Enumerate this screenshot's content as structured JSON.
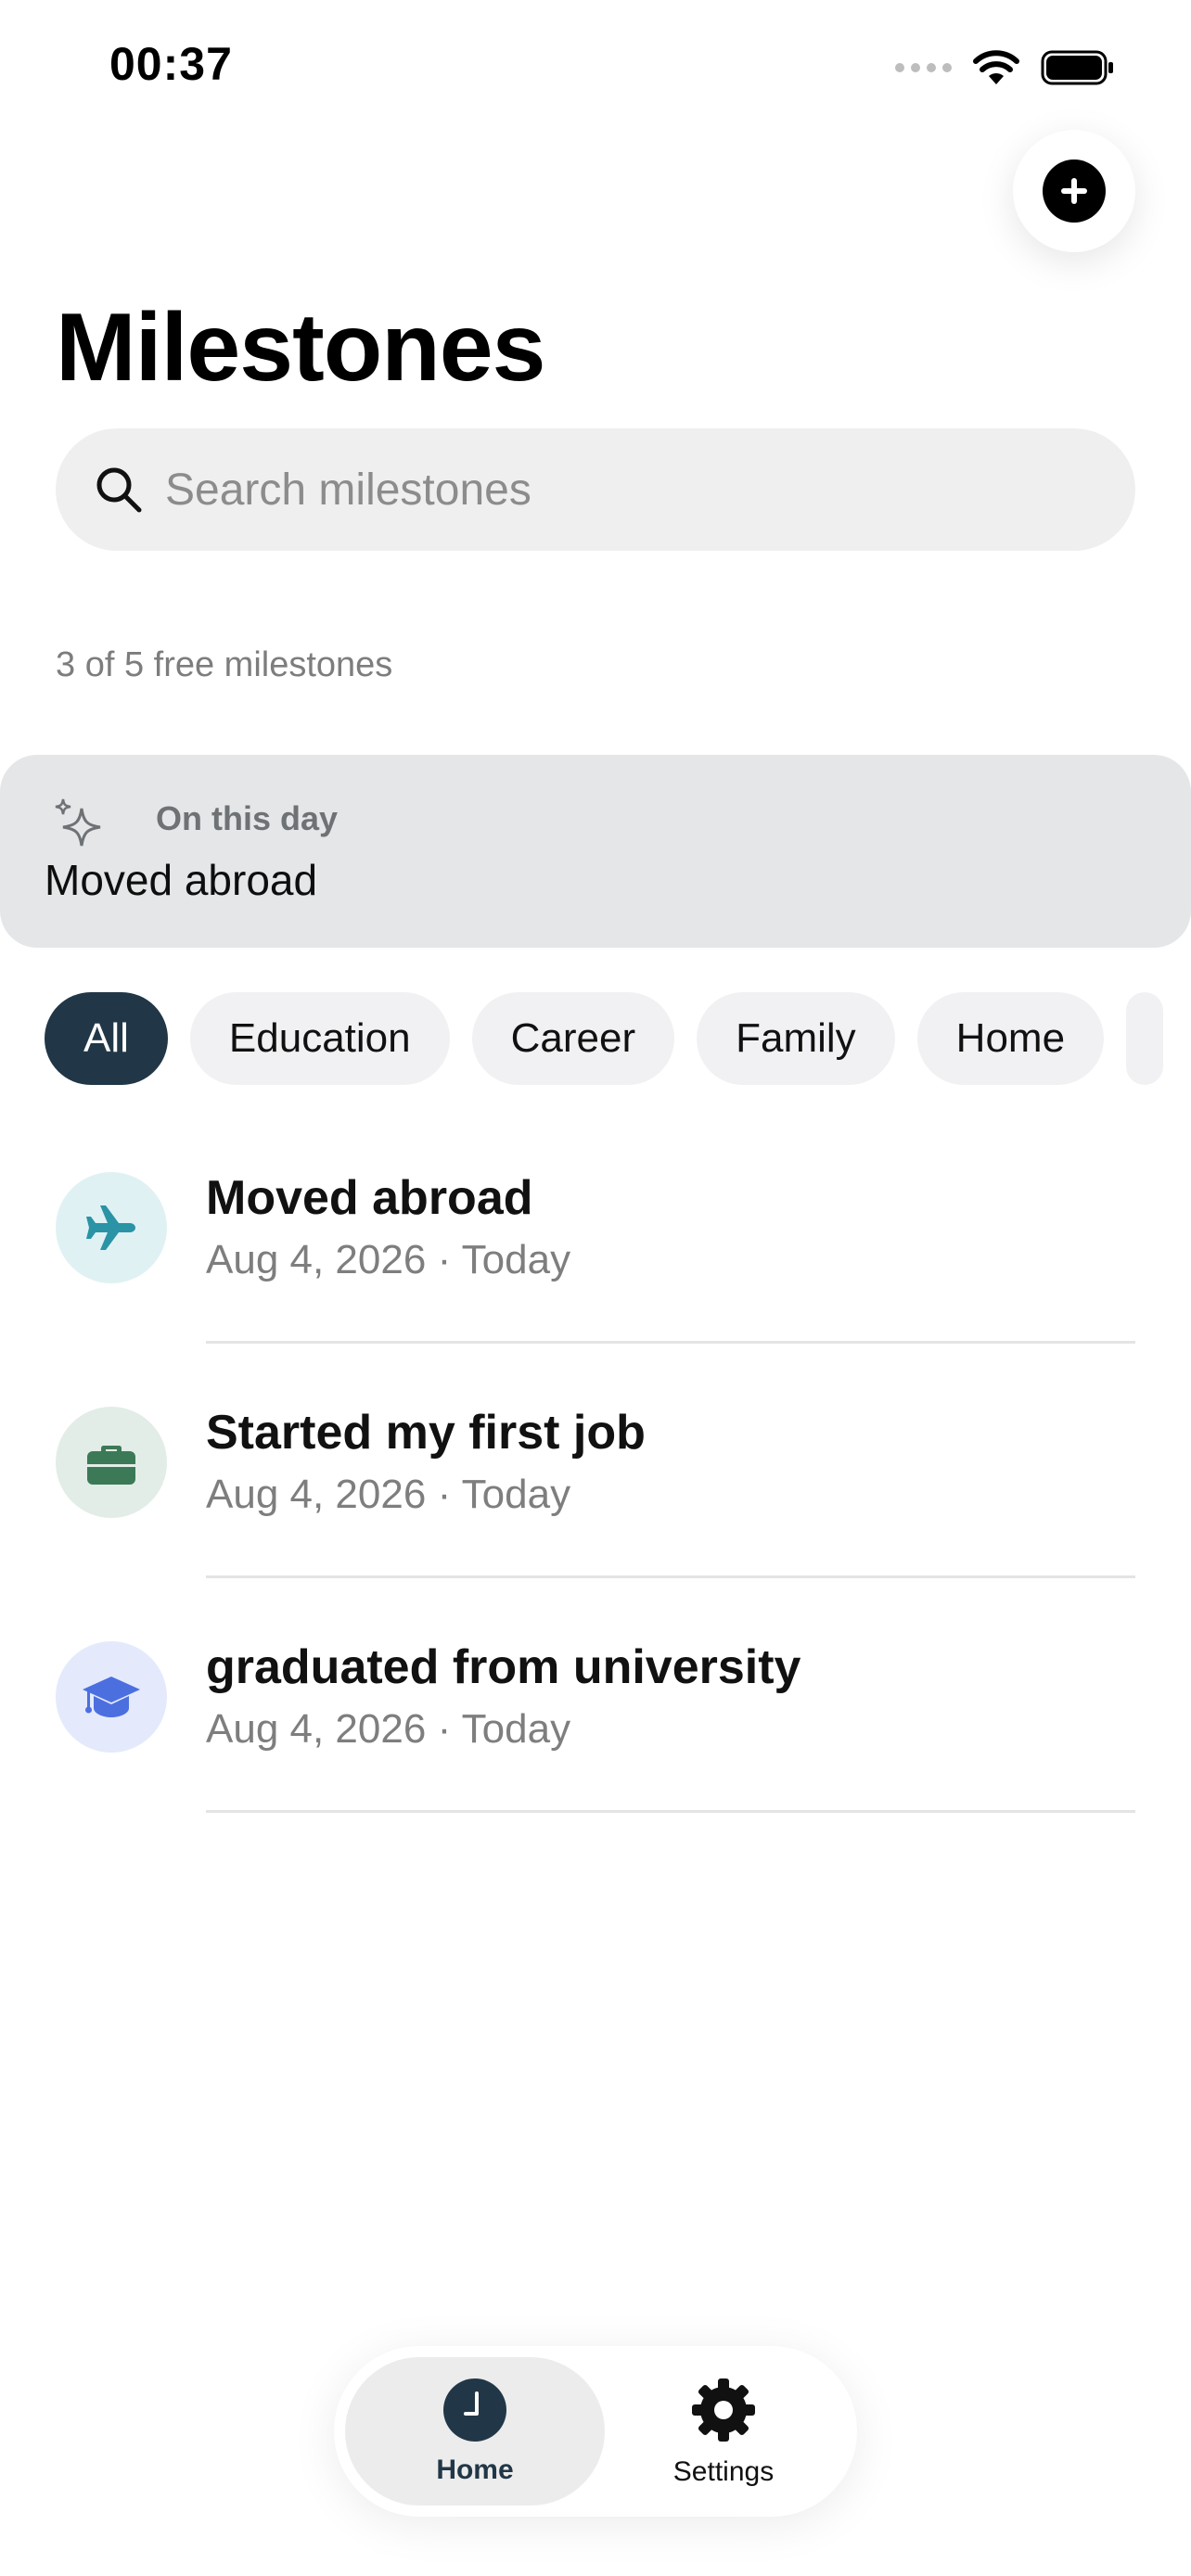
{
  "status_bar": {
    "time": "00:37"
  },
  "header": {
    "title": "Milestones",
    "add_icon": "plus-circle-icon"
  },
  "search": {
    "placeholder": "Search milestones"
  },
  "quota": {
    "text": "3 of 5 free milestones"
  },
  "on_this_day": {
    "label": "On this day",
    "title": "Moved abroad",
    "icon": "sparkle-icon"
  },
  "filters": [
    {
      "label": "All",
      "active": true
    },
    {
      "label": "Education",
      "active": false
    },
    {
      "label": "Career",
      "active": false
    },
    {
      "label": "Family",
      "active": false
    },
    {
      "label": "Home",
      "active": false
    }
  ],
  "milestones": [
    {
      "title": "Moved abroad",
      "date": "Aug 4, 2026",
      "relative": "Today",
      "icon": "airplane-icon",
      "icon_color": "#2a93a6",
      "bg_color": "#e0f1f4"
    },
    {
      "title": "Started my first job",
      "date": "Aug 4, 2026",
      "relative": "Today",
      "icon": "briefcase-icon",
      "icon_color": "#3c7a57",
      "bg_color": "#e3ede7"
    },
    {
      "title": "graduated from university",
      "date": "Aug 4, 2026",
      "relative": "Today",
      "icon": "graduation-cap-icon",
      "icon_color": "#4c6fe0",
      "bg_color": "#e4eafc"
    }
  ],
  "tab_bar": {
    "home": {
      "label": "Home",
      "icon": "clock-icon",
      "active": true
    },
    "settings": {
      "label": "Settings",
      "icon": "gear-icon",
      "active": false
    }
  },
  "colors": {
    "accent": "#213747",
    "chip_bg": "#f1f1f3",
    "card_bg": "#e4e6e8"
  }
}
